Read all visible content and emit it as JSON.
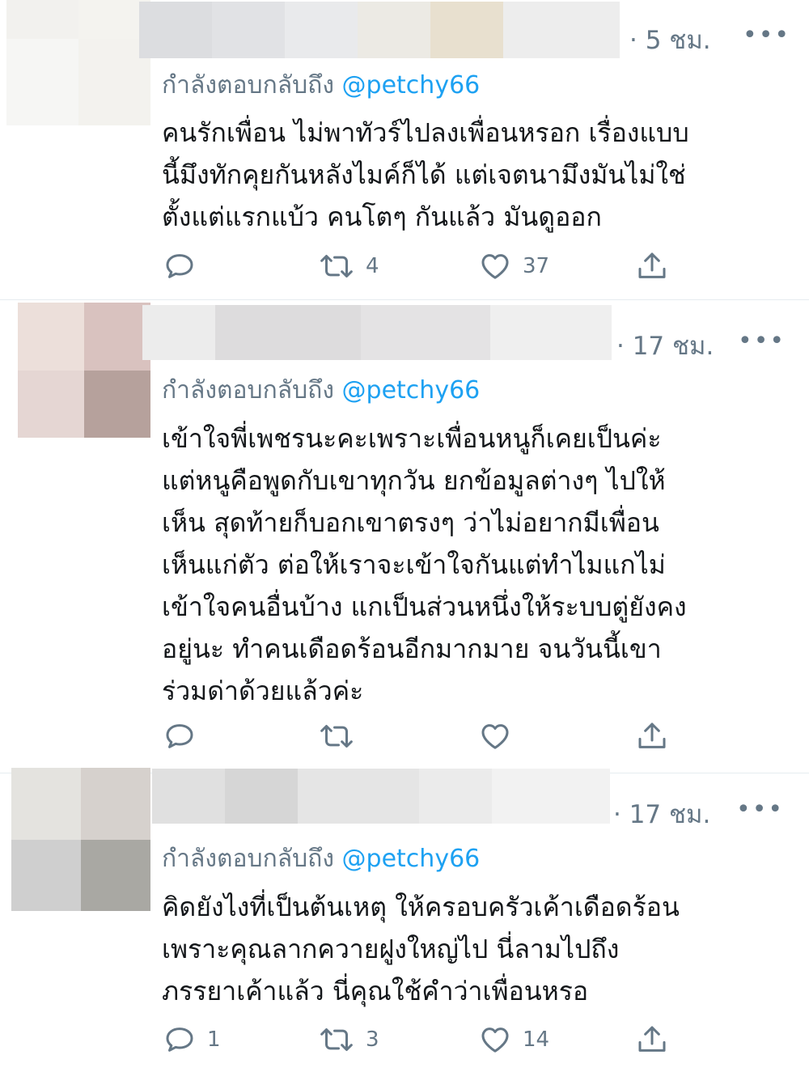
{
  "tweets": [
    {
      "time": "· 5 ชม.",
      "more": "•••",
      "reply_prefix": "กำลังตอบกลับถึง",
      "reply_handle": "@petchy66",
      "lines": [
        "คนรักเพื่อน ไม่พาทัวร์ไปลงเพื่อนหรอก เรื่องแบบ",
        "นี้มึงทักคุยกันหลังไมค์ก็ได้ แต่เจตนามึงมันไม่ใช่",
        "ตั้งแต่แรกแบ้ว คนโตๆ กันแล้ว มันดูออก"
      ],
      "replies": "",
      "retweets": "4",
      "likes": "37"
    },
    {
      "time": "· 17 ชม.",
      "more": "•••",
      "reply_prefix": "กำลังตอบกลับถึง",
      "reply_handle": "@petchy66",
      "lines": [
        "เข้าใจพี่เพชรนะคะเพราะเพื่อนหนูก็เคยเป็นค่ะ",
        "แต่หนูคือพูดกับเขาทุกวัน ยกข้อมูลต่างๆ ไปให้",
        "เห็น สุดท้ายก็บอกเขาตรงๆ ว่าไม่อยากมีเพื่อน",
        "เห็นแก่ตัว ต่อให้เราจะเข้าใจกันแต่ทำไมแกไม่",
        "เข้าใจคนอื่นบ้าง แกเป็นส่วนหนึ่งให้ระบบตู่ยังคง",
        "อยู่นะ ทำคนเดือดร้อนอีกมากมาย จนวันนี้เขา",
        "ร่วมด่าด้วยแล้วค่ะ"
      ],
      "replies": "",
      "retweets": "",
      "likes": ""
    },
    {
      "time": "· 17 ชม.",
      "more": "•••",
      "reply_prefix": "กำลังตอบกลับถึง",
      "reply_handle": "@petchy66",
      "lines": [
        "คิดยังไงที่เป็นต้นเหตุ ให้ครอบครัวเค้าเดือดร้อน",
        "เพราะคุณลากควายฝูงใหญ่ไป นี่ลามไปถึง",
        "ภรรยาเค้าแล้ว นี่คุณใช้คำว่าเพื่อนหรอ"
      ],
      "replies": "1",
      "retweets": "3",
      "likes": "14"
    }
  ],
  "colors": {
    "text": "#14171a",
    "muted": "#657786",
    "link": "#1da1f2",
    "divider": "#e6ecf0"
  },
  "icons": [
    "reply-icon",
    "retweet-icon",
    "like-icon",
    "share-icon",
    "more-icon"
  ]
}
